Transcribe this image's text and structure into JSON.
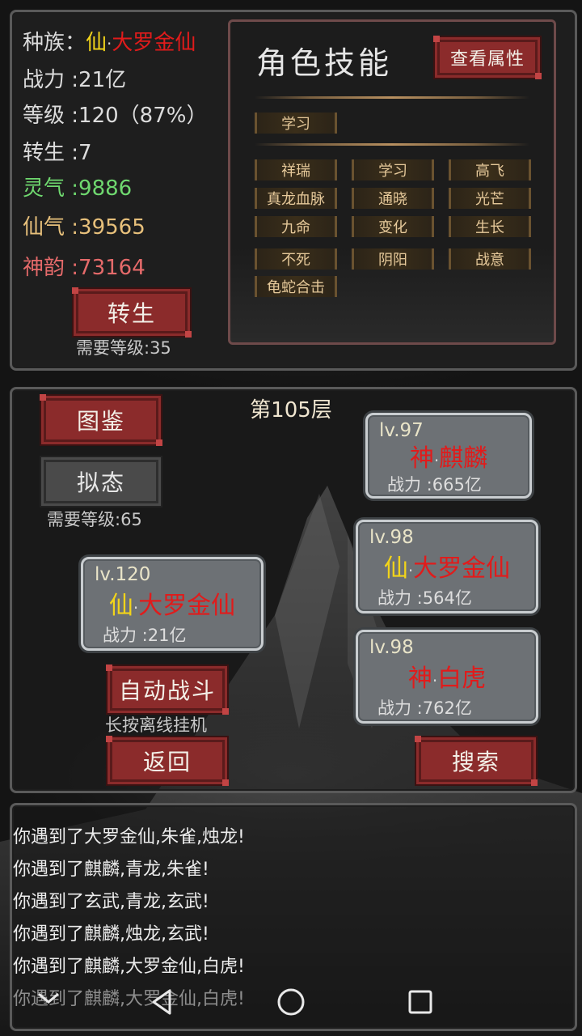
{
  "stats": {
    "race_label": "种族：",
    "race_prefix": "仙",
    "race_dot": "·",
    "race_name": "大罗金仙",
    "power_label": "战力",
    "power_value": ":21亿",
    "level_label": "等级",
    "level_value": ":120（87%）",
    "rebirth_label": "转生",
    "rebirth_value": ":7",
    "lingqi_label": "灵气",
    "lingqi_value": ":9886",
    "xianqi_label": "仙气",
    "xianqi_value": ":39565",
    "shenyun_label": "神韵",
    "shenyun_value": ":73164",
    "rebirth_button": "转生",
    "rebirth_requirement": "需要等级:35"
  },
  "skills": {
    "title": "角色技能",
    "view_attributes_button": "查看属性",
    "learned": [
      "学习"
    ],
    "list": [
      "祥瑞",
      "学习",
      "高飞",
      "真龙血脉",
      "通晓",
      "光芒",
      "九命",
      "变化",
      "生长",
      "不死",
      "阴阳",
      "战意",
      "龟蛇合击"
    ]
  },
  "battle": {
    "floor": "第105层",
    "codex_button": "图鉴",
    "mimic_button": "拟态",
    "mimic_requirement": "需要等级:65",
    "player": {
      "level": "lv.120",
      "prefix": "仙",
      "dot": "·",
      "name": "大罗金仙",
      "power": "战力 :21亿"
    },
    "enemies": [
      {
        "level": "lv.97",
        "prefix": "神",
        "dot": "·",
        "name": "麒麟",
        "power": "战力 :665亿"
      },
      {
        "level": "lv.98",
        "prefix": "仙",
        "dot": "·",
        "name": "大罗金仙",
        "power": "战力 :564亿"
      },
      {
        "level": "lv.98",
        "prefix": "神",
        "dot": "·",
        "name": "白虎",
        "power": "战力 :762亿"
      }
    ],
    "auto_battle_button": "自动战斗",
    "auto_battle_hint": "长按离线挂机",
    "back_button": "返回",
    "search_button": "搜索"
  },
  "log": [
    "你遇到了大罗金仙,朱雀,烛龙!",
    "你遇到了麒麟,青龙,朱雀!",
    "你遇到了玄武,青龙,玄武!",
    "你遇到了麒麟,烛龙,玄武!",
    "你遇到了麒麟,大罗金仙,白虎!",
    "你遇到了麒麟,大罗金仙,白虎!"
  ],
  "colors": {
    "immortal_prefix": "#f2d41a",
    "divine_prefix": "#e11b1b",
    "name_red": "#e11b1b",
    "lingqi": "#6fd86f",
    "xianqi": "#e7c07b",
    "shenyun": "#e56a6a",
    "button_red": "#8b2b2b"
  },
  "navbar_icons": [
    "back-icon",
    "home-icon",
    "recents-icon",
    "keyboard-hide-icon"
  ]
}
